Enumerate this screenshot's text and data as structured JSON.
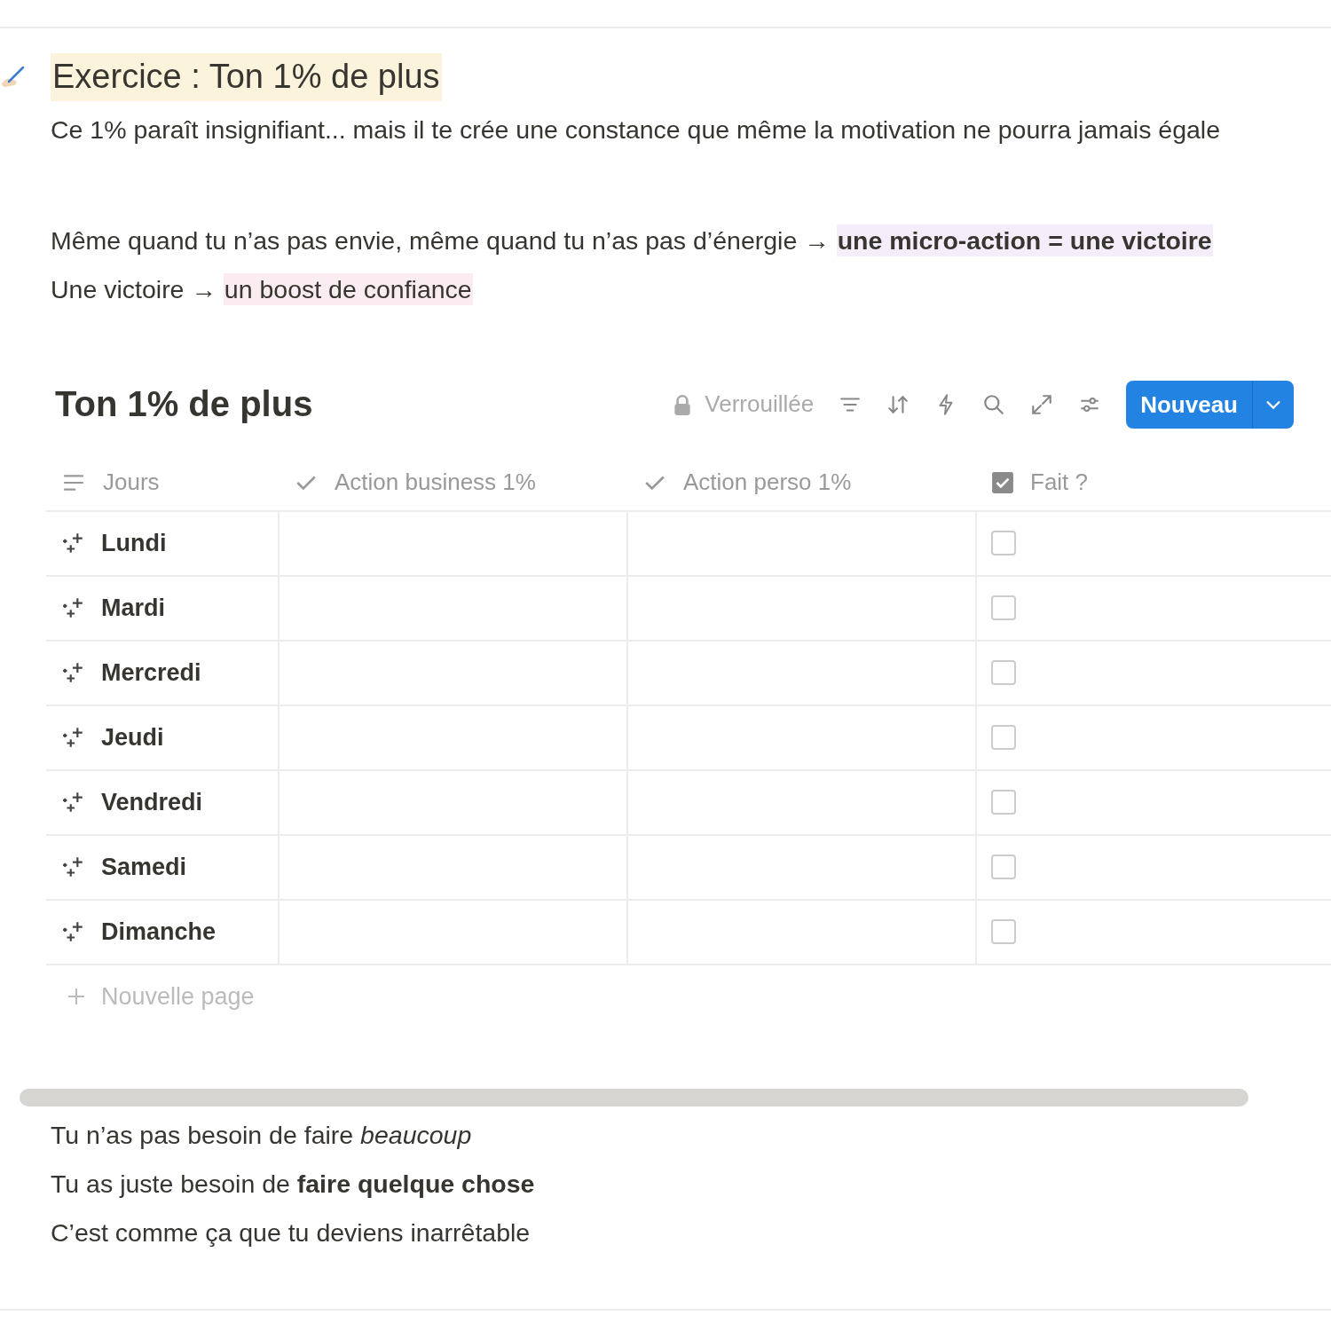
{
  "heading": {
    "text": "Exercice : Ton 1% de plus",
    "color": "#fbf3db"
  },
  "intro": "Ce 1% paraît insignifiant... mais il te crée une constance que même la motivation ne pourra jamais égale",
  "highlighted_lines": [
    [
      {
        "text": "Même quand tu n’as pas envie, même quand tu n’as pas d’énergie → "
      },
      {
        "text": "**une micro-action = une victoire**",
        "color": "#f4eefa"
      }
    ],
    [
      {
        "text": "Une victoire → "
      },
      {
        "text": "un boost de confiance",
        "color": "#fbecf1"
      }
    ]
  ],
  "database": {
    "title": "Ton 1% de plus",
    "lock_label": "Verrouillée",
    "new_button": "Nouveau",
    "columns": [
      {
        "label": "Jours",
        "kind": "title"
      },
      {
        "label": "Action business 1%",
        "kind": "check"
      },
      {
        "label": "Action perso 1%",
        "kind": "check"
      },
      {
        "label": "Fait ?",
        "kind": "checkbox"
      }
    ],
    "rows": [
      {
        "name": "Lundi",
        "done": false
      },
      {
        "name": "Mardi",
        "done": false
      },
      {
        "name": "Mercredi",
        "done": false
      },
      {
        "name": "Jeudi",
        "done": false
      },
      {
        "name": "Vendredi",
        "done": false
      },
      {
        "name": "Samedi",
        "done": false
      },
      {
        "name": "Dimanche",
        "done": false
      }
    ],
    "new_page": "Nouvelle page"
  },
  "closing": [
    "Tu n’as pas besoin de faire *beaucoup*",
    "Tu as juste besoin de **faire quelque chose**",
    "C’est comme ça que tu deviens inarrêtable"
  ]
}
